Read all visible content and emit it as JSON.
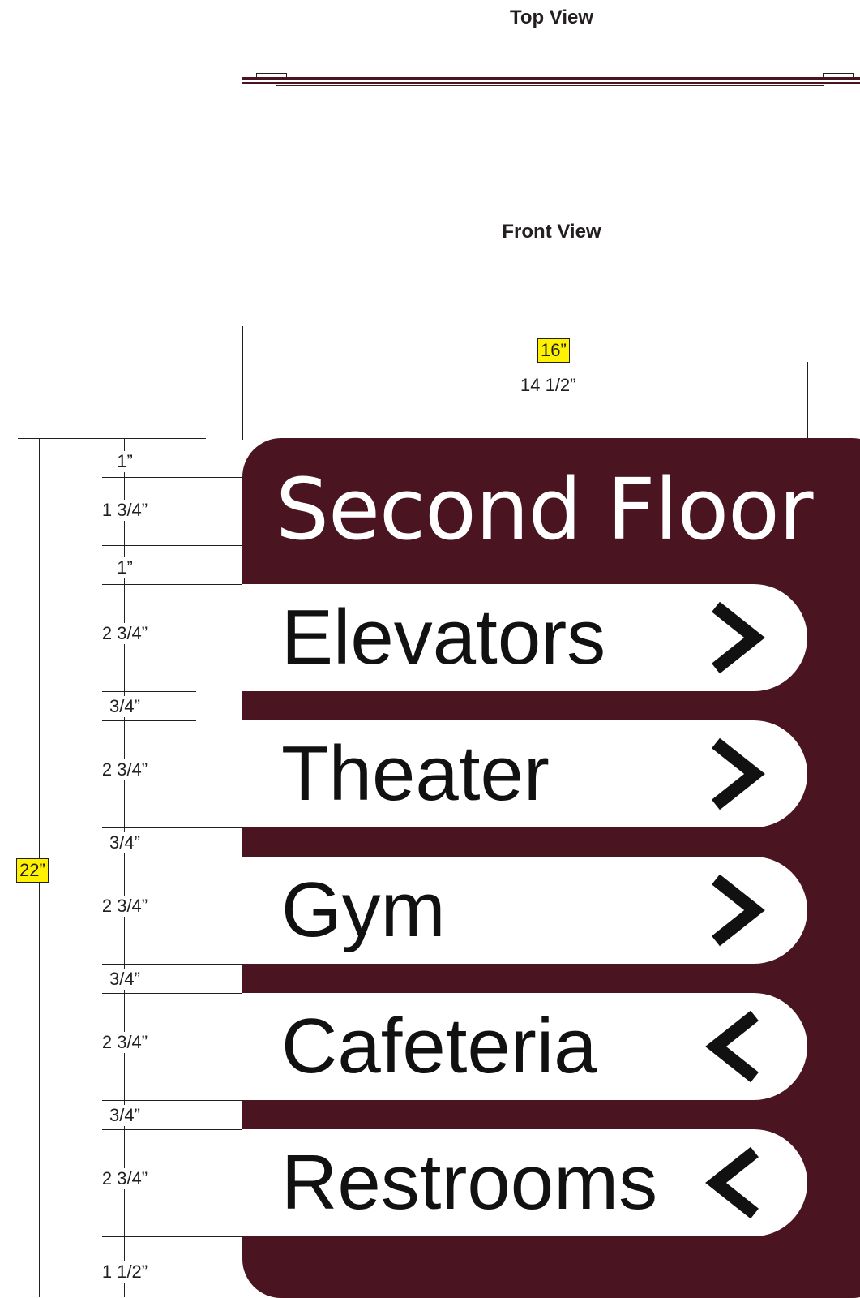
{
  "views": {
    "top_title": "Top View",
    "front_title": "Front View"
  },
  "dimensions": {
    "overall_width": "16”",
    "inner_width": "14 1/2”",
    "overall_height": "22”",
    "vertical": [
      "1”",
      "1 3/4”",
      "1”",
      "2 3/4”",
      "3/4”",
      "2 3/4”",
      "3/4”",
      "2 3/4”",
      "3/4”",
      "2 3/4”",
      "3/4”",
      "2 3/4”",
      "1 1/2”"
    ]
  },
  "sign": {
    "title": "Second Floor",
    "background_color": "#4a1520",
    "rows": [
      {
        "label": "Elevators",
        "arrow": "chevron-right-icon"
      },
      {
        "label": "Theater",
        "arrow": "chevron-right-icon"
      },
      {
        "label": "Gym",
        "arrow": "chevron-right-icon"
      },
      {
        "label": "Cafeteria",
        "arrow": "chevron-left-icon"
      },
      {
        "label": "Restrooms",
        "arrow": "chevron-left-icon"
      }
    ]
  },
  "colors": {
    "sign_maroon": "#4a1520",
    "dimension_highlight": "#fff200",
    "line": "#231f20"
  }
}
